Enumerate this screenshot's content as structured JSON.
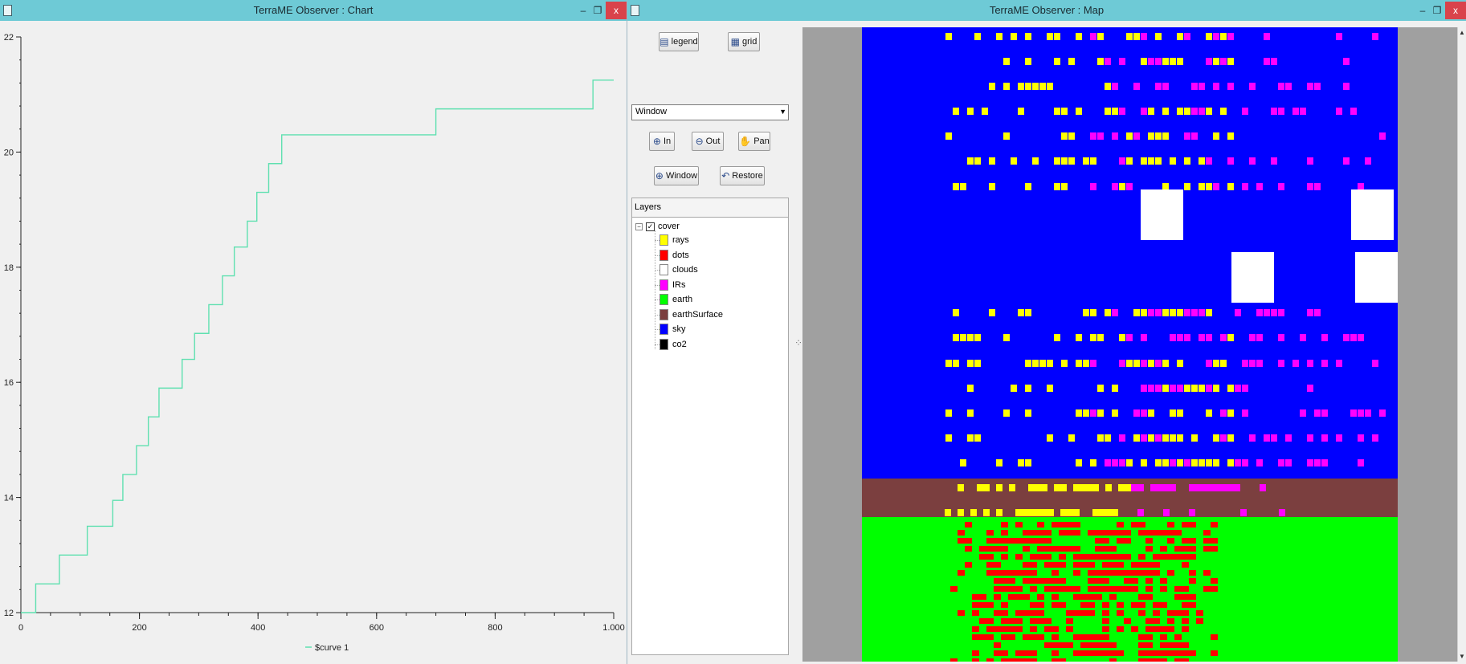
{
  "chart_window": {
    "title": "TerraME Observer : Chart",
    "minimize": "–",
    "restore": "❐",
    "close": "x"
  },
  "map_window": {
    "title": "TerraME Observer : Map",
    "minimize": "–",
    "restore": "❐",
    "close": "x"
  },
  "toolbar": {
    "legend_label": "legend",
    "grid_label": "grid",
    "zoom_select_value": "Window",
    "zoom_in_label": "In",
    "zoom_out_label": "Out",
    "pan_label": "Pan",
    "window_label": "Window",
    "restore_label": "Restore"
  },
  "layers": {
    "header": "Layers",
    "root_label": "cover",
    "items": [
      {
        "label": "rays",
        "color": "#ffff00"
      },
      {
        "label": "dots",
        "color": "#ff0000"
      },
      {
        "label": "clouds",
        "color": "#ffffff"
      },
      {
        "label": "IRs",
        "color": "#ff00ff"
      },
      {
        "label": "earth",
        "color": "#00ff00"
      },
      {
        "label": "earthSurface",
        "color": "#7b3f3f"
      },
      {
        "label": "sky",
        "color": "#0000ff"
      },
      {
        "label": "co2",
        "color": "#000000"
      }
    ]
  },
  "map_colors": {
    "sky": "#0000ff",
    "earthSurface": "#7b3f3f",
    "earth": "#00ff00",
    "rays": "#ffff00",
    "dots": "#ff0000",
    "IRs": "#ff00ff",
    "clouds": "#ffffff",
    "background": "#a0a0a0"
  },
  "chart_data": {
    "type": "line",
    "title": "",
    "xlabel": "",
    "ylabel": "",
    "xlim": [
      0,
      1000
    ],
    "ylim": [
      12,
      22
    ],
    "x_ticks": [
      0,
      200,
      400,
      600,
      800,
      1000
    ],
    "x_tick_labels": [
      "0",
      "200",
      "400",
      "600",
      "800",
      "1.000"
    ],
    "y_ticks": [
      12,
      14,
      16,
      18,
      20,
      22
    ],
    "y_tick_labels": [
      "12",
      "14",
      "16",
      "18",
      "20",
      "22"
    ],
    "grid": false,
    "legend_position": "bottom",
    "series": [
      {
        "name": "$curve 1",
        "color": "#5fe0b0",
        "step": true,
        "x": [
          0,
          25,
          65,
          112,
          155,
          172,
          195,
          215,
          233,
          272,
          293,
          317,
          340,
          360,
          382,
          398,
          418,
          440,
          700,
          965,
          1000
        ],
        "y": [
          12.0,
          12.5,
          13.0,
          13.5,
          13.95,
          14.4,
          14.9,
          15.4,
          15.9,
          16.4,
          16.85,
          17.35,
          17.85,
          18.35,
          18.8,
          19.3,
          19.8,
          20.3,
          20.75,
          21.25,
          21.25
        ]
      }
    ]
  }
}
